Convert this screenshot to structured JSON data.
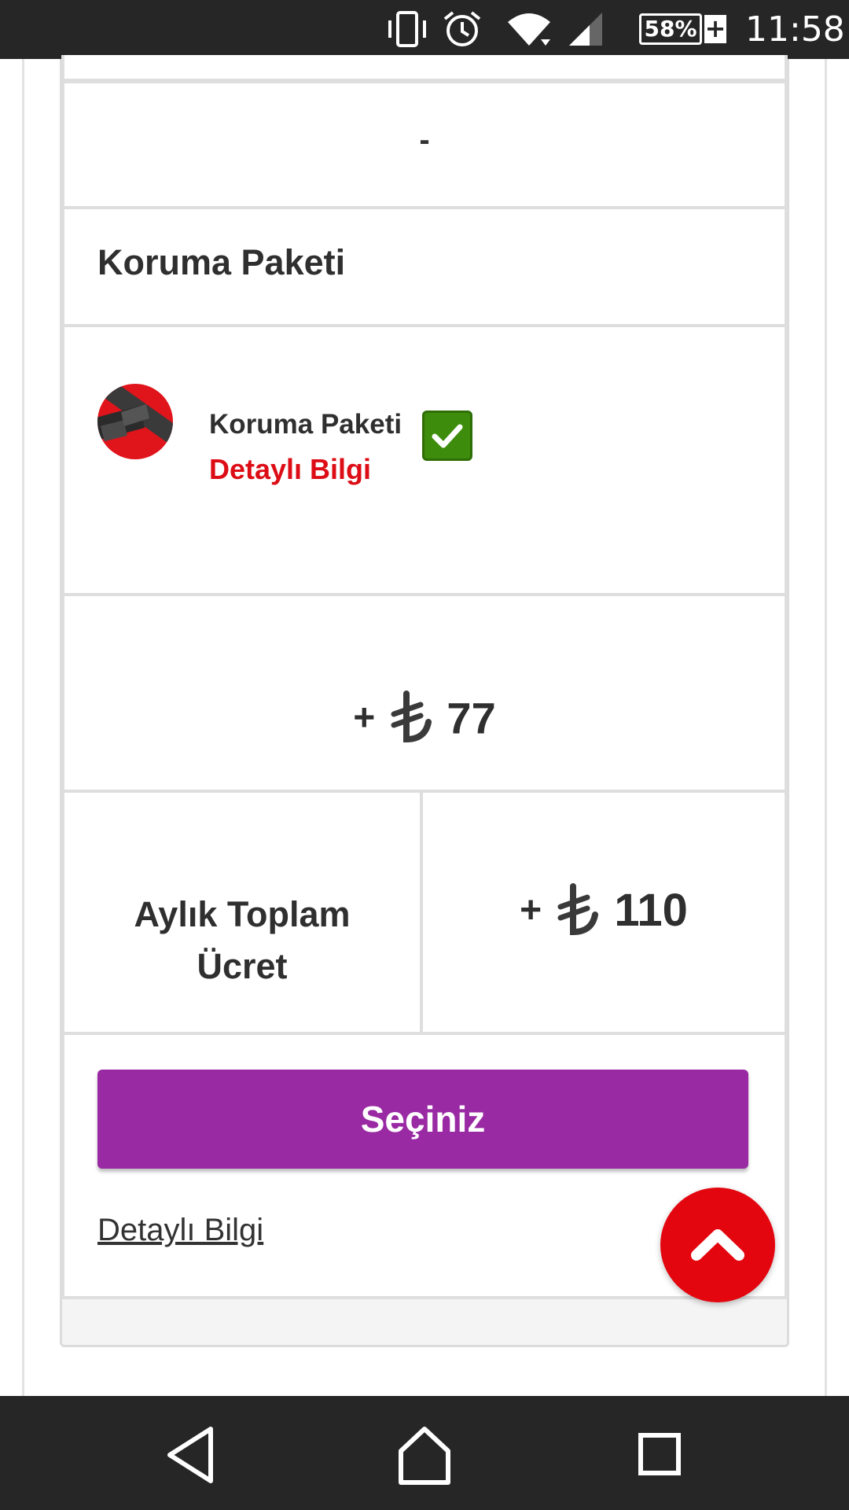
{
  "status_bar": {
    "battery_percent": "58%",
    "battery_charging_symbol": "+",
    "time": "11:58",
    "icons": [
      "vibrate-icon",
      "alarm-icon",
      "wifi-icon",
      "signal-icon",
      "battery-icon"
    ]
  },
  "table": {
    "dash_value": "-",
    "section_title": "Koruma Paketi",
    "package": {
      "name": "Koruma Paketi",
      "detail_link": "Detaylı Bilgi",
      "checked": true,
      "icon": "seatbelt-icon"
    },
    "package_price": {
      "prefix": "+",
      "currency_icon": "turkish-lira-icon",
      "amount": "77"
    },
    "monthly_total": {
      "label_line1": "Aylık Toplam",
      "label_line2": "Ücret",
      "prefix": "+",
      "currency_icon": "turkish-lira-icon",
      "amount": "110"
    },
    "select_button": "Seçiniz",
    "detail_link": "Detaylı Bilgi"
  },
  "fab": {
    "icon": "chevron-up-icon"
  },
  "nav_bar": {
    "icons": [
      "back-icon",
      "home-icon",
      "recents-icon"
    ]
  },
  "colors": {
    "accent_purple": "#9a2aa4",
    "brand_red": "#e3060f",
    "link_red": "#dd0d16",
    "check_green": "#3d8c0c"
  }
}
